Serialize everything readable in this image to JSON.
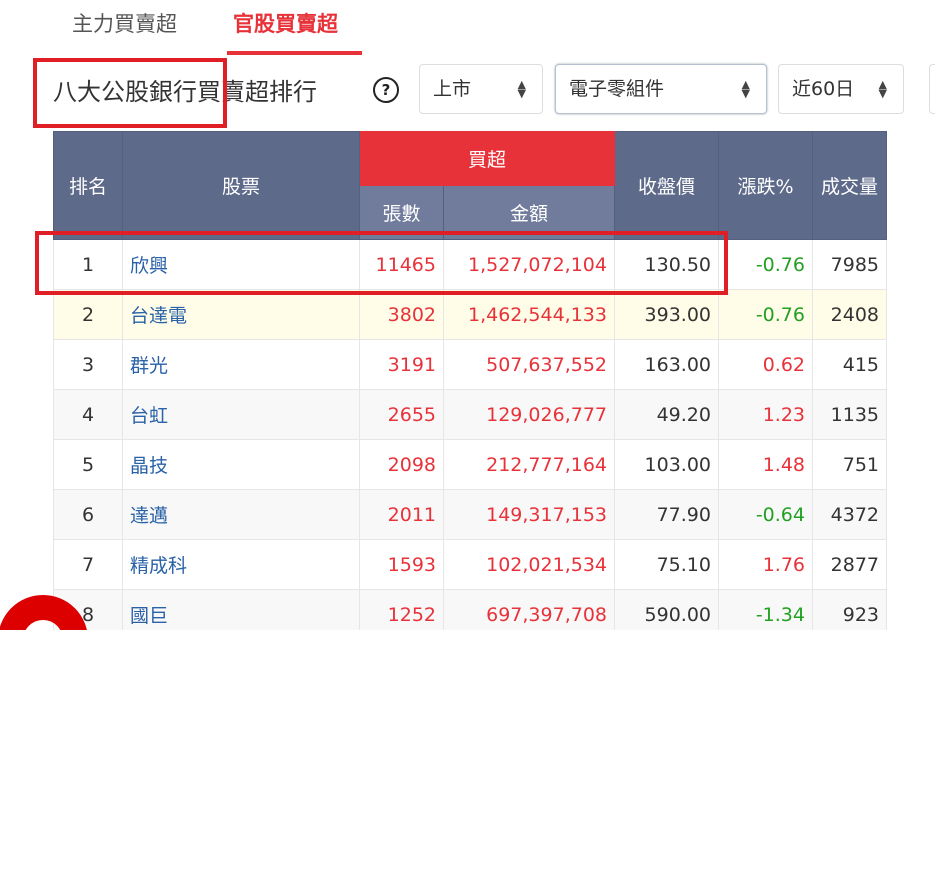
{
  "tabs": [
    {
      "label": "主力買賣超"
    },
    {
      "label": "官股買賣超",
      "active": true
    }
  ],
  "title": "八大公股銀行買賣超排行",
  "help_icon": "?",
  "filters": {
    "market": "上市",
    "industry": "電子零組件",
    "period": "近60日"
  },
  "table": {
    "headers": {
      "rank": "排名",
      "stock": "股票",
      "buy_group": "買超",
      "lots": "張數",
      "amount": "金額",
      "close": "收盤價",
      "change": "漲跌%",
      "volume": "成交量"
    },
    "rows": [
      {
        "rank": "1",
        "stock": "欣興",
        "lots": "11465",
        "amount": "1,527,072,104",
        "close": "130.50",
        "change": "-0.76",
        "volume": "7985"
      },
      {
        "rank": "2",
        "stock": "台達電",
        "lots": "3802",
        "amount": "1,462,544,133",
        "close": "393.00",
        "change": "-0.76",
        "volume": "2408"
      },
      {
        "rank": "3",
        "stock": "群光",
        "lots": "3191",
        "amount": "507,637,552",
        "close": "163.00",
        "change": "0.62",
        "volume": "415"
      },
      {
        "rank": "4",
        "stock": "台虹",
        "lots": "2655",
        "amount": "129,026,777",
        "close": "49.20",
        "change": "1.23",
        "volume": "1135"
      },
      {
        "rank": "5",
        "stock": "晶技",
        "lots": "2098",
        "amount": "212,777,164",
        "close": "103.00",
        "change": "1.48",
        "volume": "751"
      },
      {
        "rank": "6",
        "stock": "達邁",
        "lots": "2011",
        "amount": "149,317,153",
        "close": "77.90",
        "change": "-0.64",
        "volume": "4372"
      },
      {
        "rank": "7",
        "stock": "精成科",
        "lots": "1593",
        "amount": "102,021,534",
        "close": "75.10",
        "change": "1.76",
        "volume": "2877"
      },
      {
        "rank": "8",
        "stock": "國巨",
        "lots": "1252",
        "amount": "697,397,708",
        "close": "590.00",
        "change": "-1.34",
        "volume": "923"
      }
    ]
  },
  "colors": {
    "accent": "#e8323a",
    "header": "#5e6a8a",
    "up": "#e8323a",
    "down": "#22a022"
  }
}
